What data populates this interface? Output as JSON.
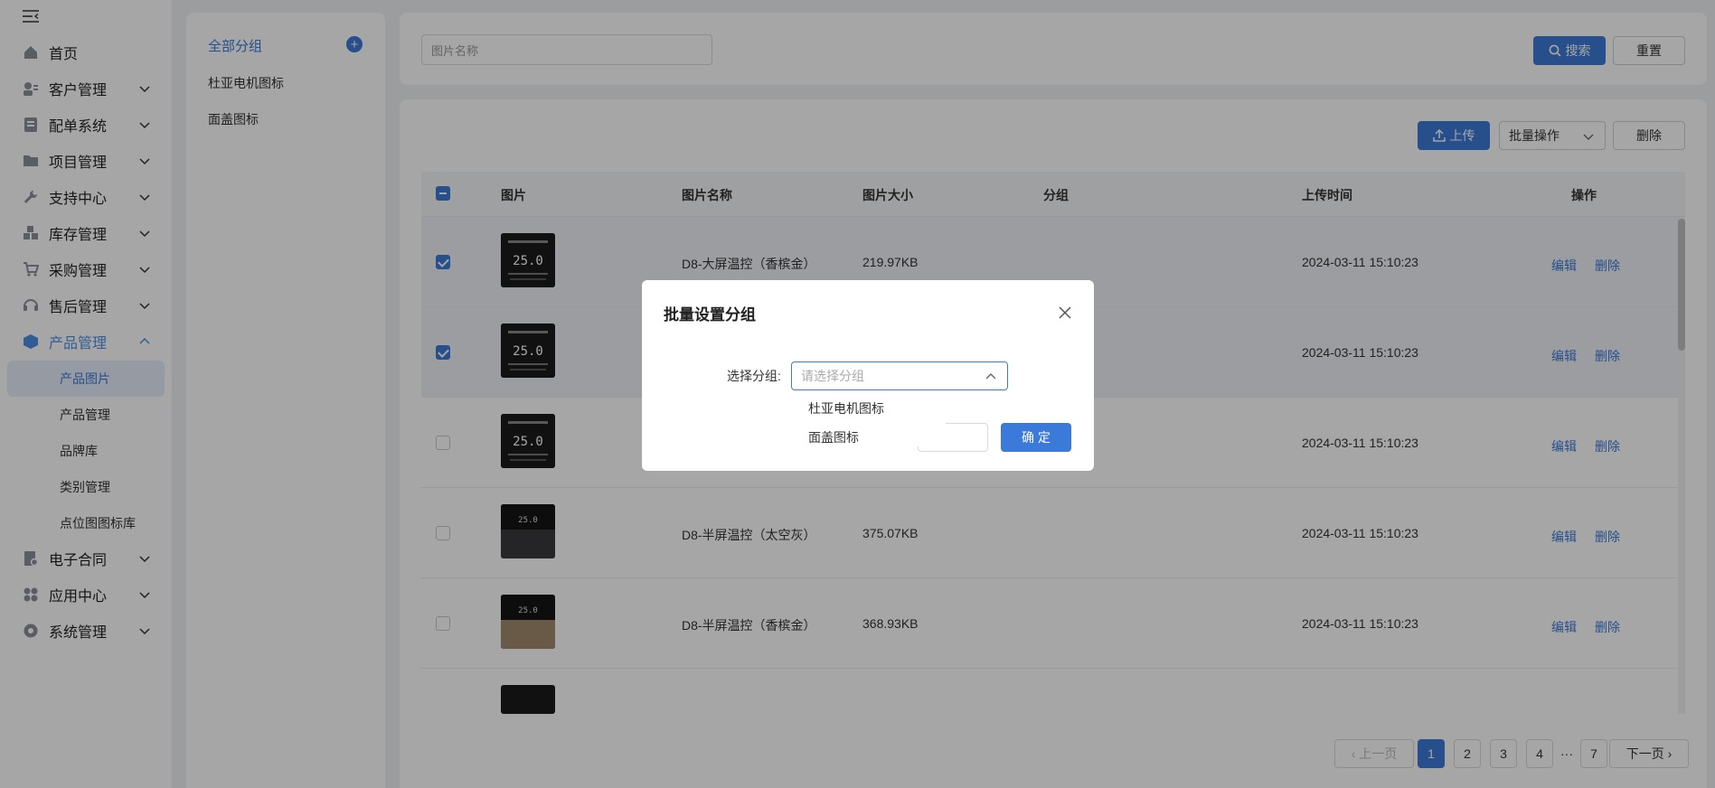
{
  "sidebar": {
    "items": [
      {
        "label": "首页",
        "icon": "home-icon"
      },
      {
        "label": "客户管理",
        "icon": "customer-icon"
      },
      {
        "label": "配单系统",
        "icon": "order-icon"
      },
      {
        "label": "项目管理",
        "icon": "folder-icon"
      },
      {
        "label": "支持中心",
        "icon": "wrench-icon"
      },
      {
        "label": "库存管理",
        "icon": "inventory-icon"
      },
      {
        "label": "采购管理",
        "icon": "cart-icon"
      },
      {
        "label": "售后管理",
        "icon": "headset-icon"
      },
      {
        "label": "产品管理",
        "icon": "box-icon"
      },
      {
        "label": "电子合同",
        "icon": "contract-icon"
      },
      {
        "label": "应用中心",
        "icon": "apps-icon"
      },
      {
        "label": "系统管理",
        "icon": "settings-icon"
      }
    ],
    "sub_items": [
      "产品图片",
      "产品管理",
      "品牌库",
      "类别管理",
      "点位图图标库"
    ]
  },
  "groups": {
    "all": "全部分组",
    "items": [
      "杜亚电机图标",
      "面盖图标"
    ]
  },
  "search": {
    "placeholder": "图片名称",
    "search_label": "搜索",
    "reset_label": "重置"
  },
  "toolbar": {
    "upload_label": "上传",
    "batch_label": "批量操作",
    "delete_label": "删除"
  },
  "table": {
    "headers": [
      "图片",
      "图片名称",
      "图片大小",
      "分组",
      "上传时间",
      "操作"
    ],
    "rows": [
      {
        "name": "D8-大屏温控（香槟金）",
        "size": "219.97KB",
        "group": "",
        "time": "2024-03-11 15:10:23",
        "checked": true
      },
      {
        "name": "",
        "size": "",
        "group": "",
        "time": "2024-03-11 15:10:23",
        "checked": true
      },
      {
        "name": "",
        "size": "",
        "group": "",
        "time": "2024-03-11 15:10:23",
        "checked": false
      },
      {
        "name": "D8-半屏温控（太空灰）",
        "size": "375.07KB",
        "group": "",
        "time": "2024-03-11 15:10:23",
        "checked": false
      },
      {
        "name": "D8-半屏温控（香槟金）",
        "size": "368.93KB",
        "group": "",
        "time": "2024-03-11 15:10:23",
        "checked": false
      }
    ],
    "edit_label": "编辑",
    "delete_label": "删除",
    "thumb_reading": "25.0"
  },
  "pagination": {
    "prev": "上一页",
    "next": "下一页",
    "pages": [
      "1",
      "2",
      "3",
      "4",
      "···",
      "7"
    ],
    "current": "1"
  },
  "modal": {
    "title": "批量设置分组",
    "field_label": "选择分组:",
    "select_placeholder": "请选择分组",
    "options": [
      "杜亚电机图标",
      "面盖图标"
    ],
    "ok_label": "确 定"
  },
  "colors": {
    "primary": "#3b7ad8",
    "overlay": "rgba(0,0,0,0.35)"
  }
}
